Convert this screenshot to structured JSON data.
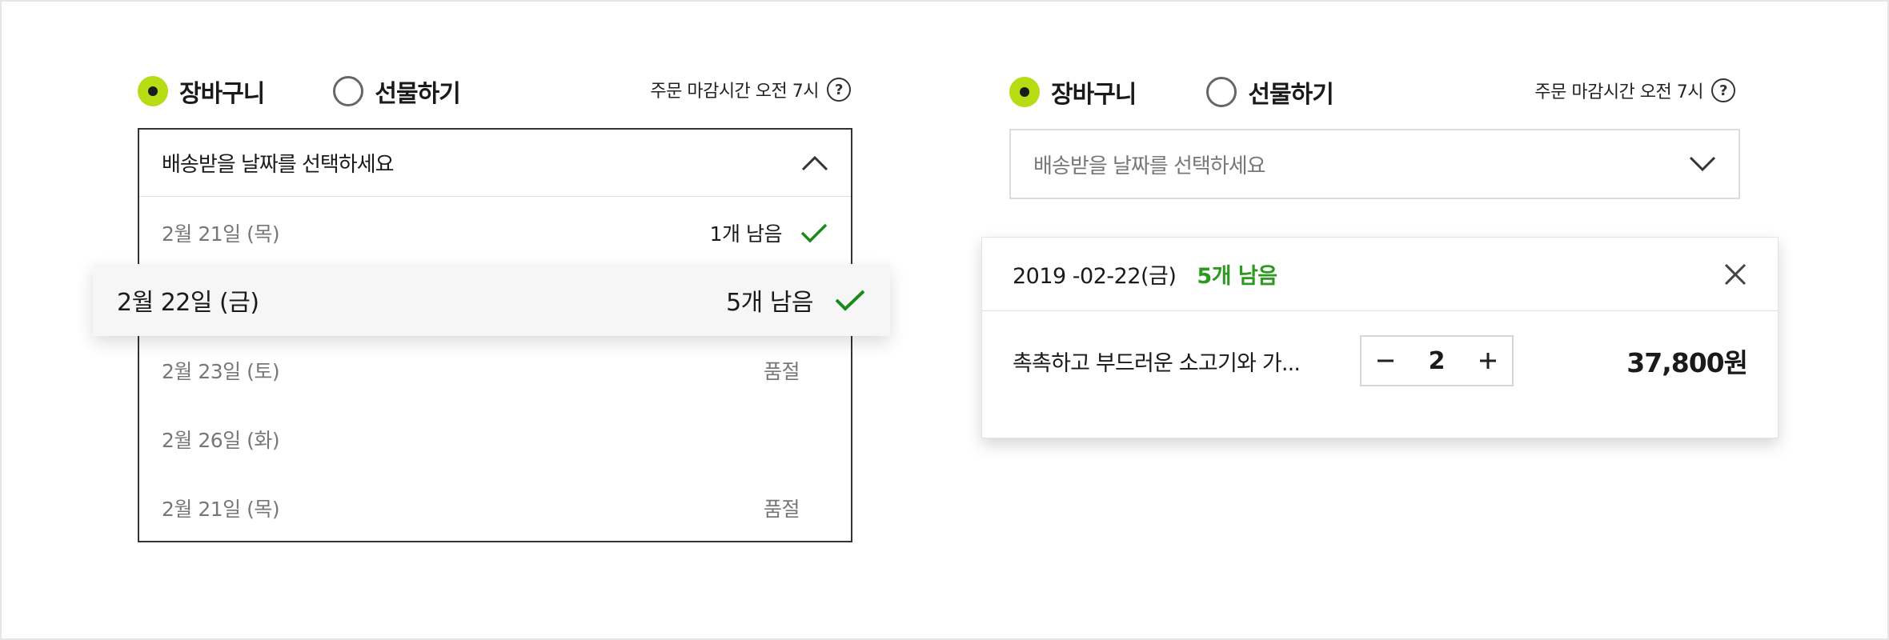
{
  "left_panel": {
    "radio_cart": {
      "label": "장바구니",
      "checked": true
    },
    "radio_gift": {
      "label": "선물하기",
      "checked": false
    },
    "deadline": "주문 마감시간 오전 7시",
    "help_label": "?",
    "dropdown": {
      "placeholder": "배송받을 날짜를 선택하세요",
      "expanded": true,
      "options": [
        {
          "date": "2월 21일 (목)",
          "status": "1개 남음",
          "checked": true
        },
        {
          "date": "2월 22일 (금)",
          "status": "5개 남음",
          "checked": true,
          "highlighted": true
        },
        {
          "date": "2월 23일 (토)",
          "status": "품절",
          "checked": false
        },
        {
          "date": "2월 26일 (화)",
          "status": "",
          "checked": false
        },
        {
          "date": "2월 21일 (목)",
          "status": "품절",
          "checked": false
        }
      ]
    }
  },
  "right_panel": {
    "radio_cart": {
      "label": "장바구니",
      "checked": true
    },
    "radio_gift": {
      "label": "선물하기",
      "checked": false
    },
    "deadline": "주문 마감시간 오전 7시",
    "help_label": "?",
    "dropdown": {
      "placeholder": "배송받을 날짜를 선택하세요",
      "expanded": false
    },
    "selected_item": {
      "date": "2019 -02-22(금)",
      "stock": "5개 남음",
      "product_name": "촉촉하고 부드러운 소고기와 가...",
      "quantity": "2",
      "price": "37,800원"
    }
  },
  "colors": {
    "accent_radio": "#b6dc13",
    "check_green": "#1a8a1a",
    "stock_green": "#2c9a1f"
  },
  "icons": {
    "check": "check-icon",
    "chevron_up": "chevron-up-icon",
    "chevron_down": "chevron-down-icon",
    "close": "close-icon",
    "minus": "minus-icon",
    "plus": "plus-icon",
    "help": "question-circle-icon"
  }
}
